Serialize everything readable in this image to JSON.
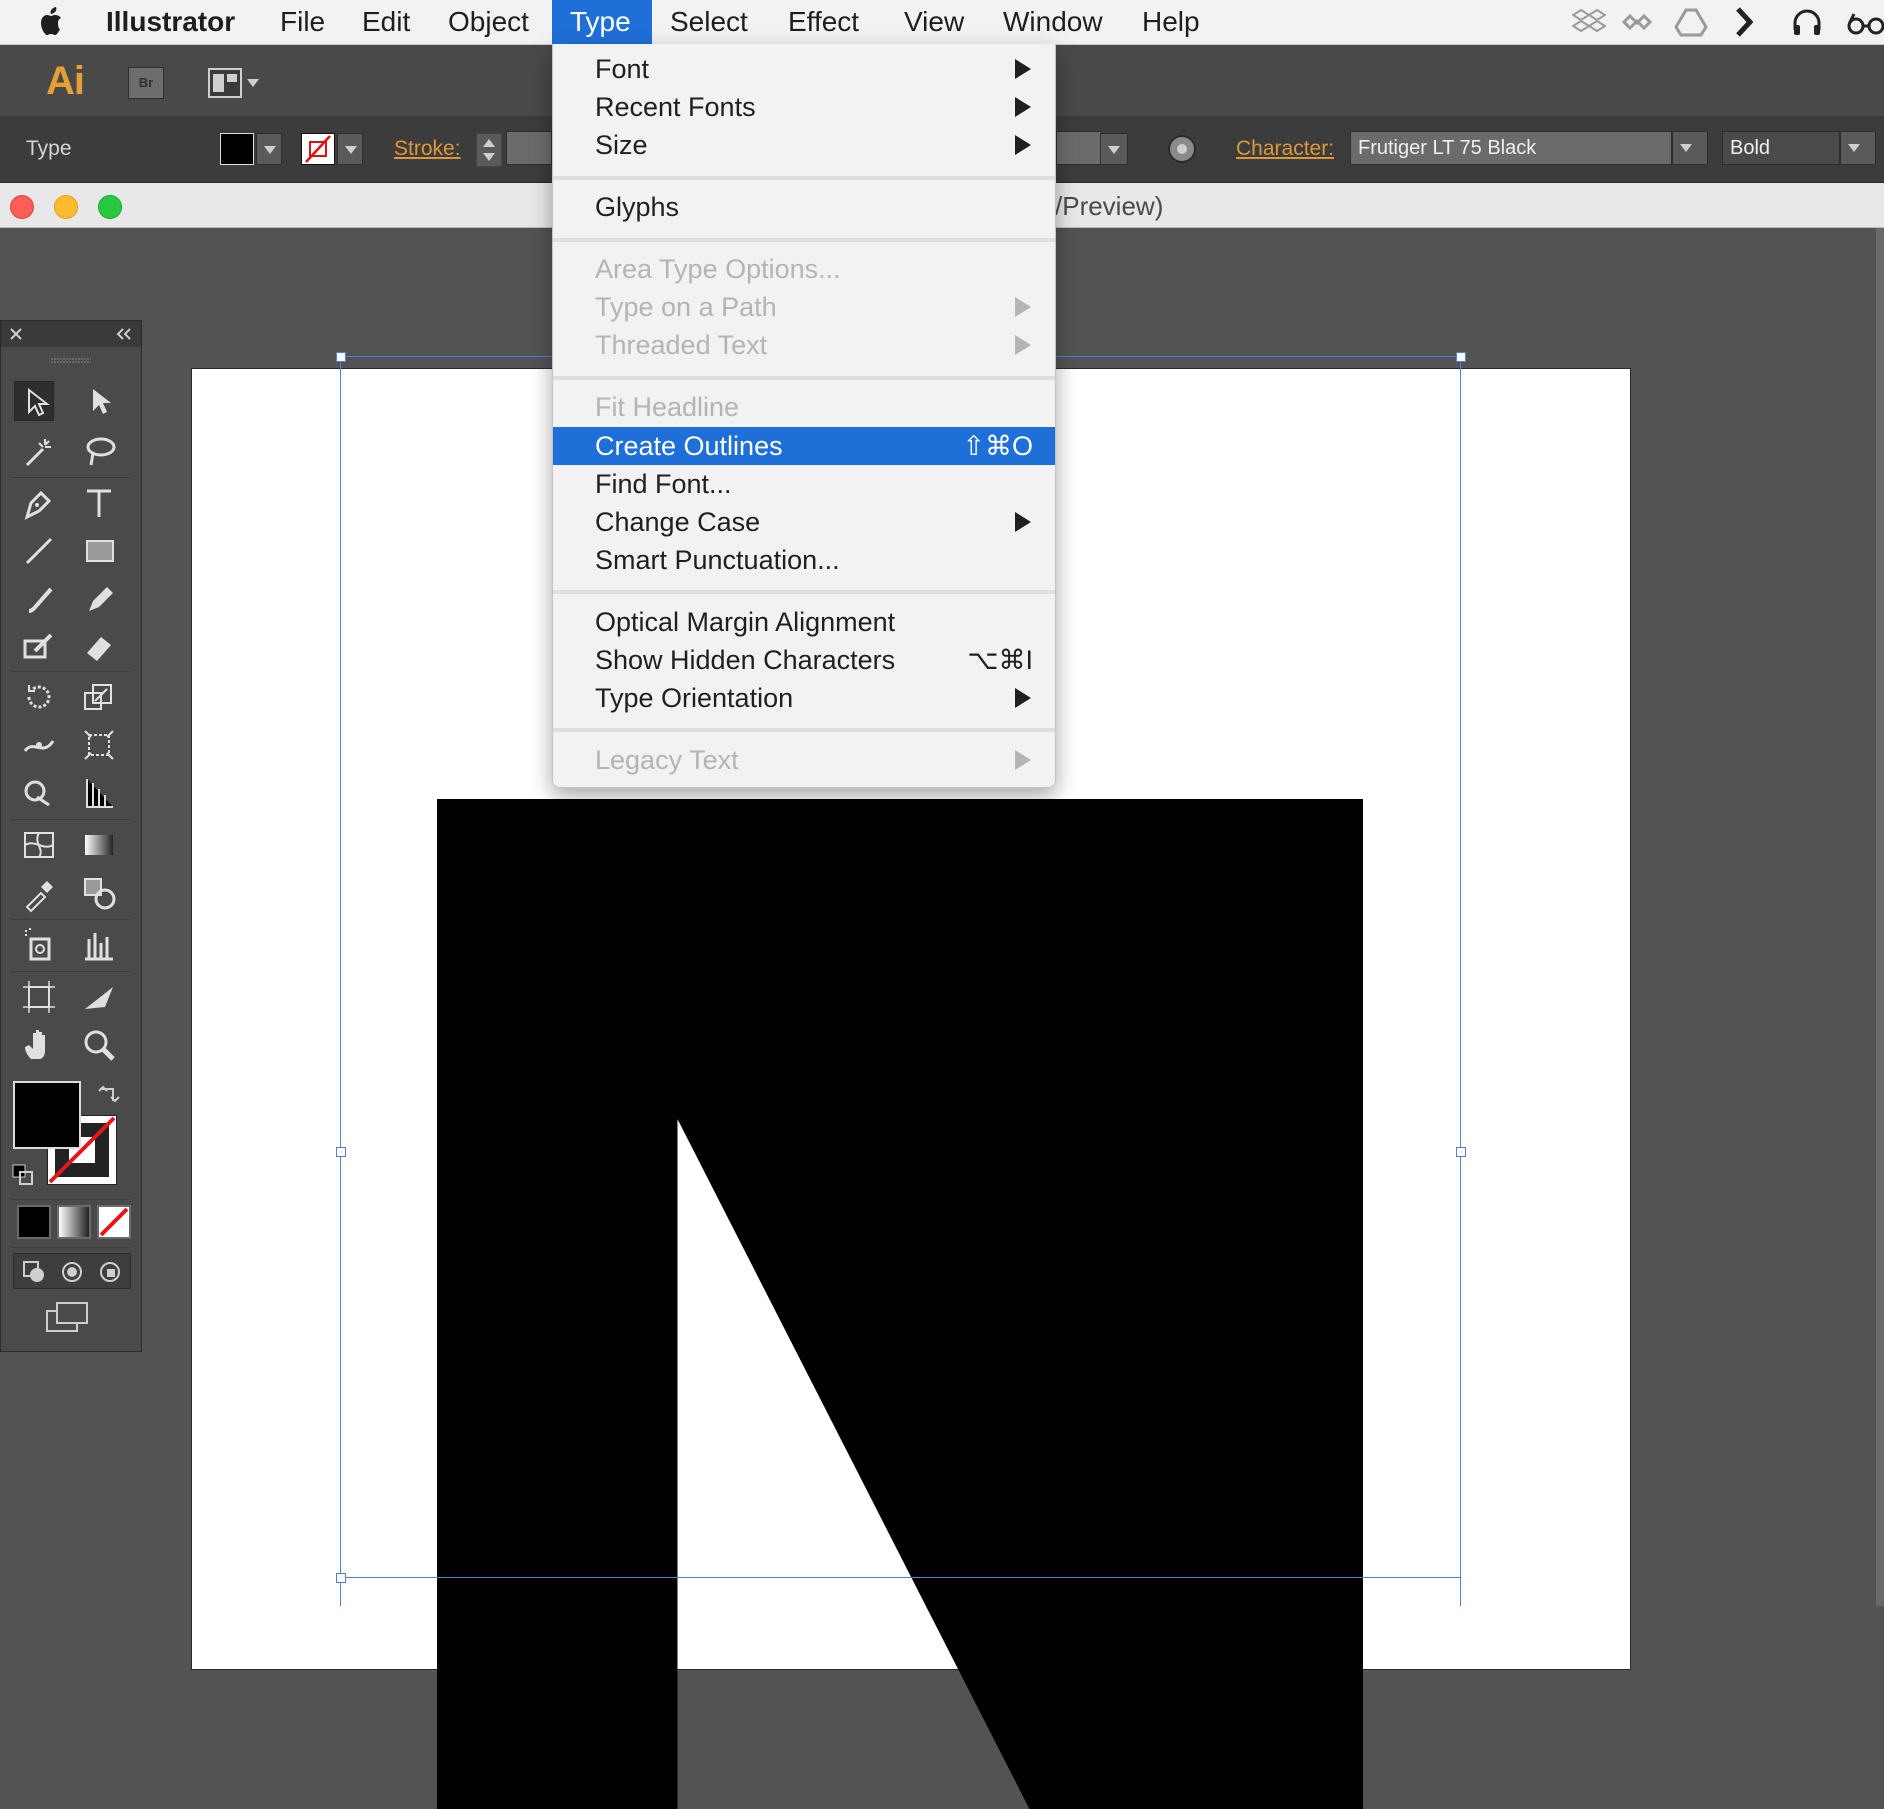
{
  "menubar": {
    "app_name": "Illustrator",
    "items": [
      "File",
      "Edit",
      "Object",
      "Type",
      "Select",
      "Effect",
      "View",
      "Window",
      "Help"
    ],
    "active_item": "Type",
    "tray_icons": [
      "dropbox-icon",
      "creative-cloud-icon",
      "google-drive-icon",
      "chevron-icon",
      "headphones-icon",
      "glasses-icon"
    ]
  },
  "appbar": {
    "logo": "Ai",
    "bridge": "Br"
  },
  "control_bar": {
    "selection_label": "Type",
    "stroke_label": "Stroke:",
    "character_label": "Character:",
    "font_family": "Frutiger LT 75 Black",
    "font_style": "Bold"
  },
  "document": {
    "title_fragment": "/Preview)",
    "glyph": "N"
  },
  "type_menu": {
    "items": [
      {
        "label": "Font",
        "submenu": true,
        "enabled": true
      },
      {
        "label": "Recent Fonts",
        "submenu": true,
        "enabled": true
      },
      {
        "label": "Size",
        "submenu": true,
        "enabled": true
      },
      {
        "label": "Glyphs",
        "enabled": true
      },
      {
        "label": "Area Type Options...",
        "enabled": false
      },
      {
        "label": "Type on a Path",
        "submenu": true,
        "enabled": false
      },
      {
        "label": "Threaded Text",
        "submenu": true,
        "enabled": false
      },
      {
        "label": "Fit Headline",
        "enabled": false
      },
      {
        "label": "Create Outlines",
        "shortcut": "⇧⌘O",
        "enabled": true,
        "highlighted": true
      },
      {
        "label": "Find Font...",
        "enabled": true
      },
      {
        "label": "Change Case",
        "submenu": true,
        "enabled": true
      },
      {
        "label": "Smart Punctuation...",
        "enabled": true
      },
      {
        "label": "Optical Margin Alignment",
        "enabled": true
      },
      {
        "label": "Show Hidden Characters",
        "shortcut": "⌥⌘I",
        "enabled": true
      },
      {
        "label": "Type Orientation",
        "submenu": true,
        "enabled": true
      },
      {
        "label": "Legacy Text",
        "submenu": true,
        "enabled": false
      }
    ]
  },
  "colors": {
    "highlight": "#1f6fd8",
    "accent_orange": "#e0973a",
    "selection_blue": "#4f7de3",
    "fill": "#000000"
  }
}
